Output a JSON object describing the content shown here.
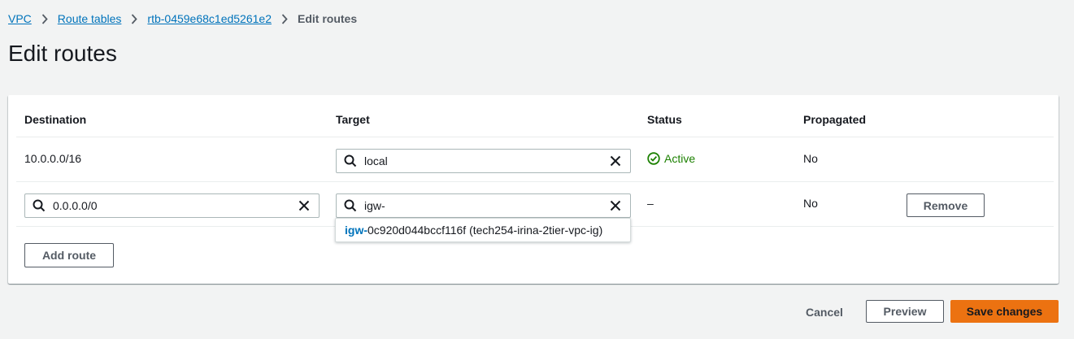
{
  "breadcrumb": {
    "items": [
      {
        "label": "VPC"
      },
      {
        "label": "Route tables"
      },
      {
        "label": "rtb-0459e68c1ed5261e2"
      }
    ],
    "current": "Edit routes"
  },
  "page": {
    "title": "Edit routes"
  },
  "table": {
    "columns": [
      "Destination",
      "Target",
      "Status",
      "Propagated"
    ],
    "rows": [
      {
        "destination": "10.0.0.0/16",
        "target": "local",
        "status": "Active",
        "propagated": "No"
      },
      {
        "destination": "0.0.0.0/0",
        "target": "igw-",
        "status": "–",
        "propagated": "No",
        "remove_label": "Remove"
      }
    ],
    "add_route_label": "Add route"
  },
  "target_suggestion": {
    "match": "igw-",
    "rest": "0c920d044bccf116f (tech254-irina-2tier-vpc-ig)"
  },
  "footer": {
    "cancel_label": "Cancel",
    "preview_label": "Preview",
    "save_label": "Save changes"
  },
  "colors": {
    "link": "#0073bb",
    "status_active": "#1d8102",
    "primary_button": "#ec7211",
    "page_background": "#f2f3f3"
  },
  "icons": {
    "breadcrumb_separator": "chevron-right-icon",
    "search": "search-icon",
    "clear": "close-icon",
    "status": "check-circle-icon"
  }
}
